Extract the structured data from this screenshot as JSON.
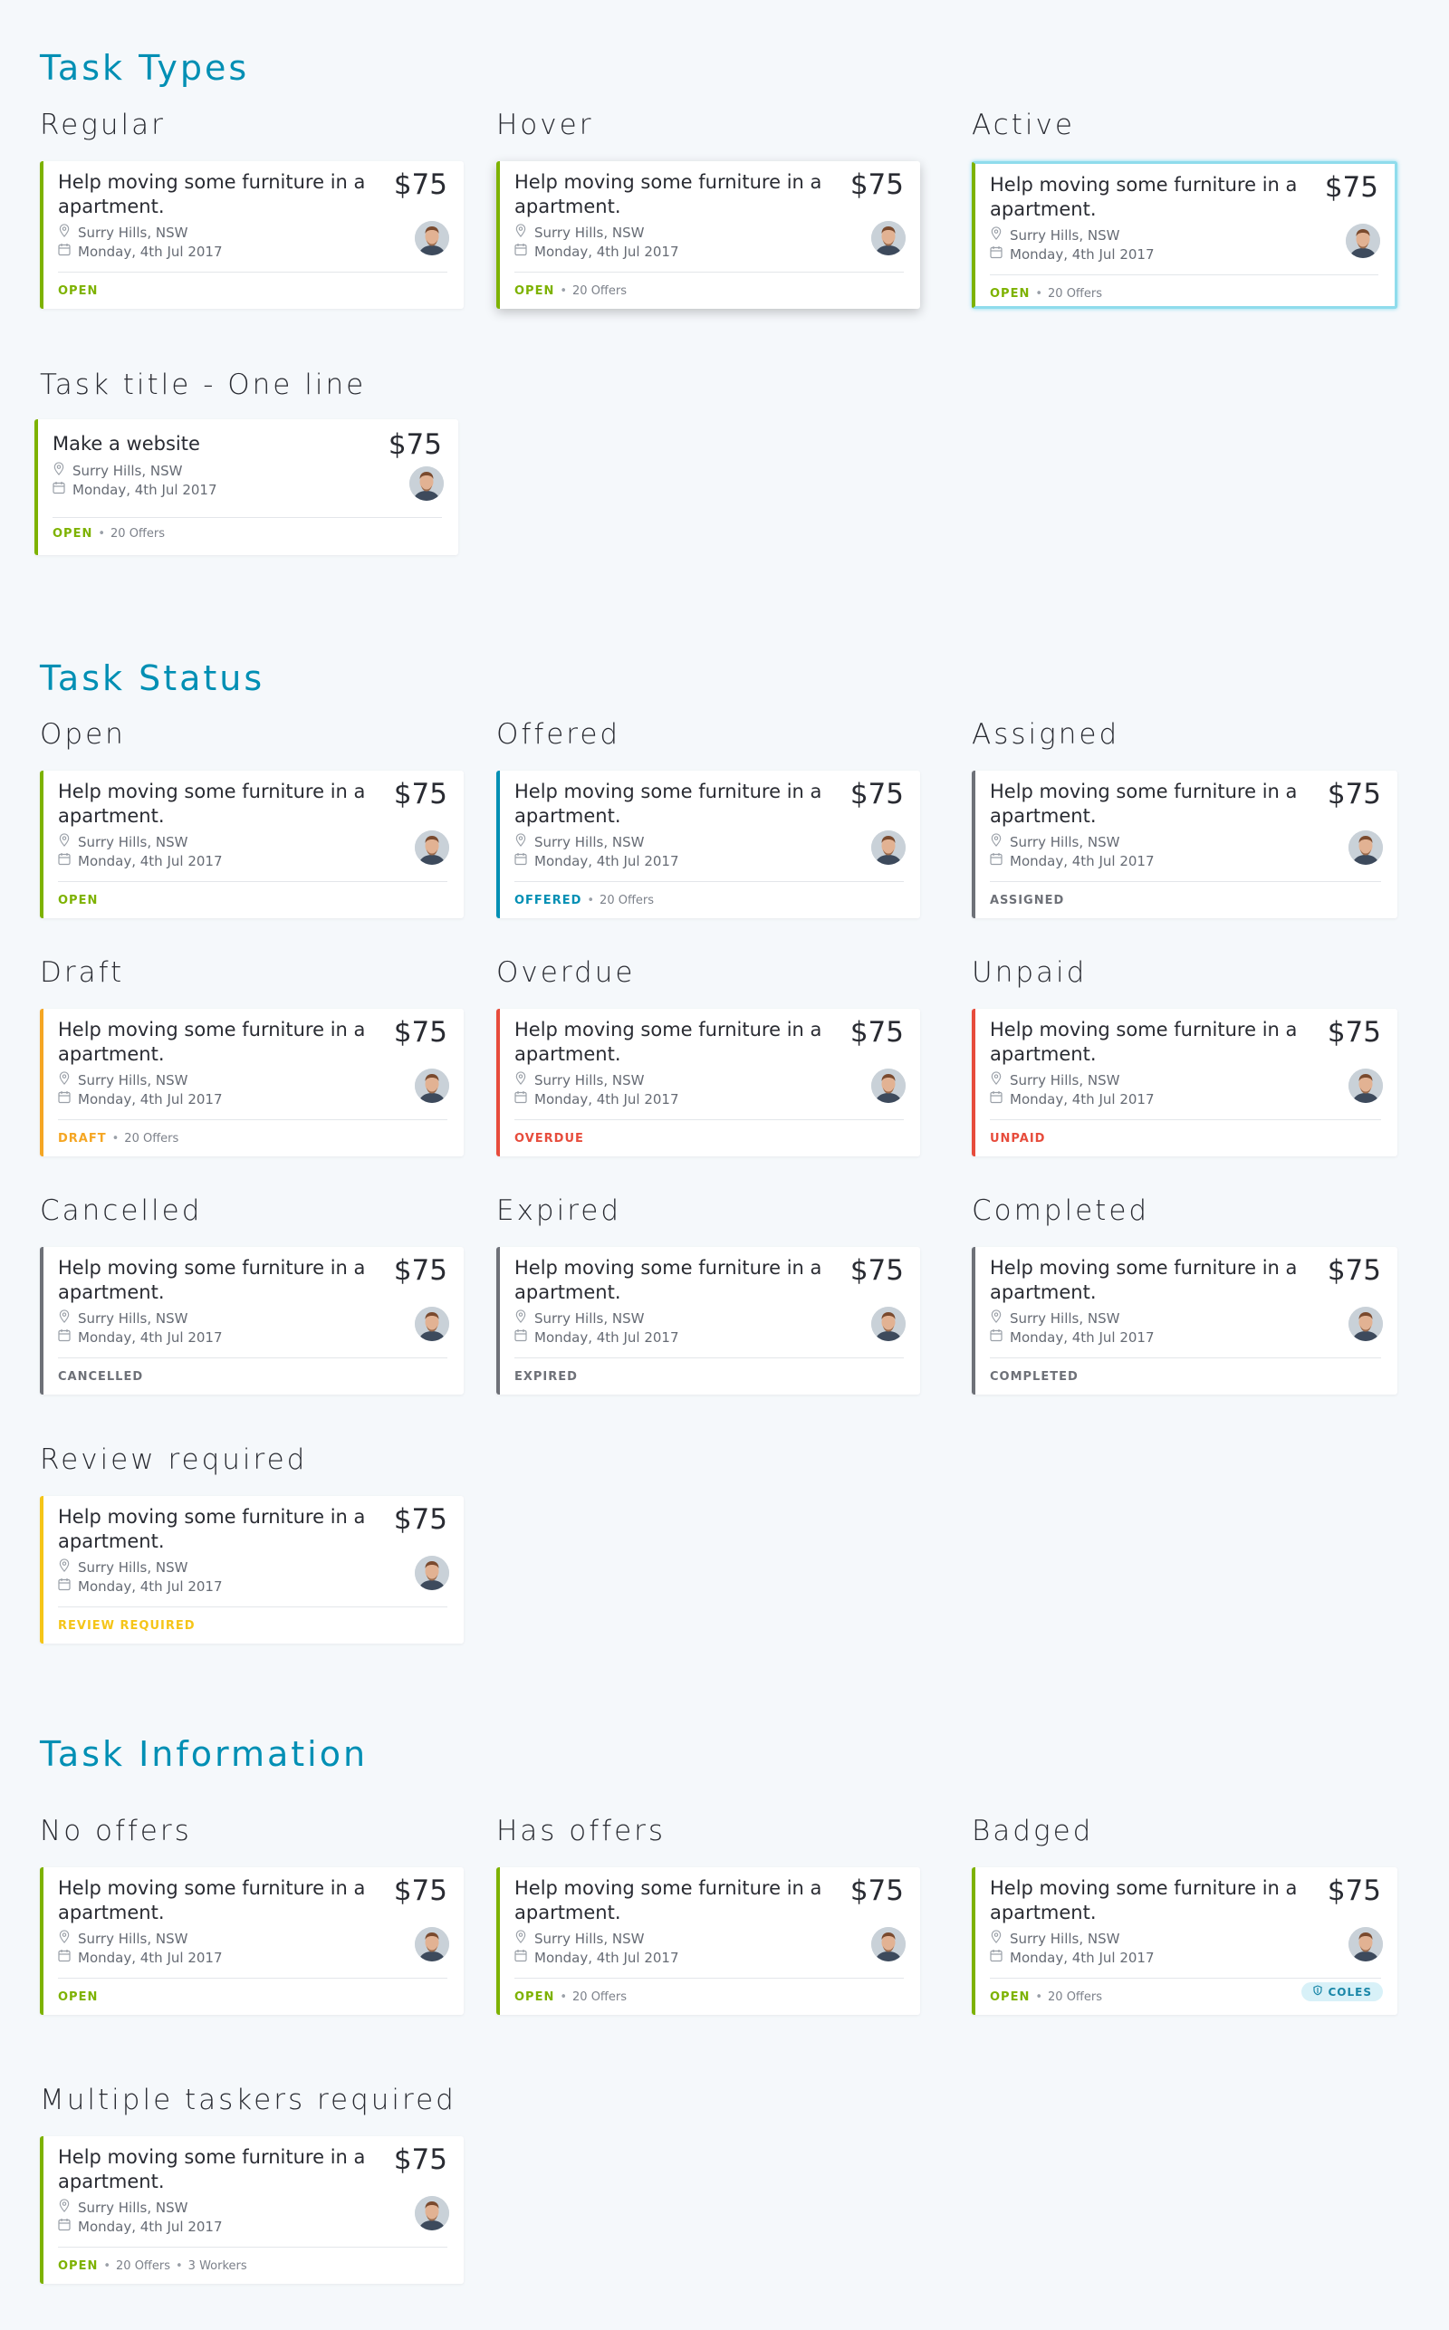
{
  "card": {
    "title": "Help moving some furniture in a apartment.",
    "title_short": "Make a website",
    "price": "$75",
    "location": "Surry Hills, NSW",
    "date": "Monday, 4th Jul 2017",
    "offers": "20 Offers",
    "workers": "3 Workers",
    "badge": "COLES"
  },
  "sections": {
    "types": "Task Types",
    "status": "Task Status",
    "info": "Task Information"
  },
  "labels": {
    "regular": "Regular",
    "hover": "Hover",
    "active": "Active",
    "one_line": "Task title - One line",
    "open": "Open",
    "offered": "Offered",
    "assigned": "Assigned",
    "draft": "Draft",
    "overdue": "Overdue",
    "unpaid": "Unpaid",
    "cancelled": "Cancelled",
    "expired": "Expired",
    "completed": "Completed",
    "review": "Review required",
    "no_offers": "No offers",
    "has_offers": "Has offers",
    "badged": "Badged",
    "multiple": "Multiple taskers required"
  },
  "statuses": {
    "open": "OPEN",
    "offered": "OFFERED",
    "assigned": "ASSIGNED",
    "draft": "DRAFT",
    "overdue": "OVERDUE",
    "unpaid": "UNPAID",
    "cancelled": "CANCELLED",
    "expired": "EXPIRED",
    "completed": "COMPLETED",
    "review": "REVIEW REQUIRED"
  },
  "colors": {
    "open": "#7db200",
    "offered": "#008fb4",
    "assigned": "#6e7178",
    "draft": "#f5a623",
    "overdue": "#e74c3c",
    "unpaid": "#e74c3c",
    "cancelled": "#6e7178",
    "expired": "#6e7178",
    "completed": "#6e7178",
    "review": "#f5c518",
    "section": "#008fb4",
    "active_outline": "#8fdcec"
  }
}
